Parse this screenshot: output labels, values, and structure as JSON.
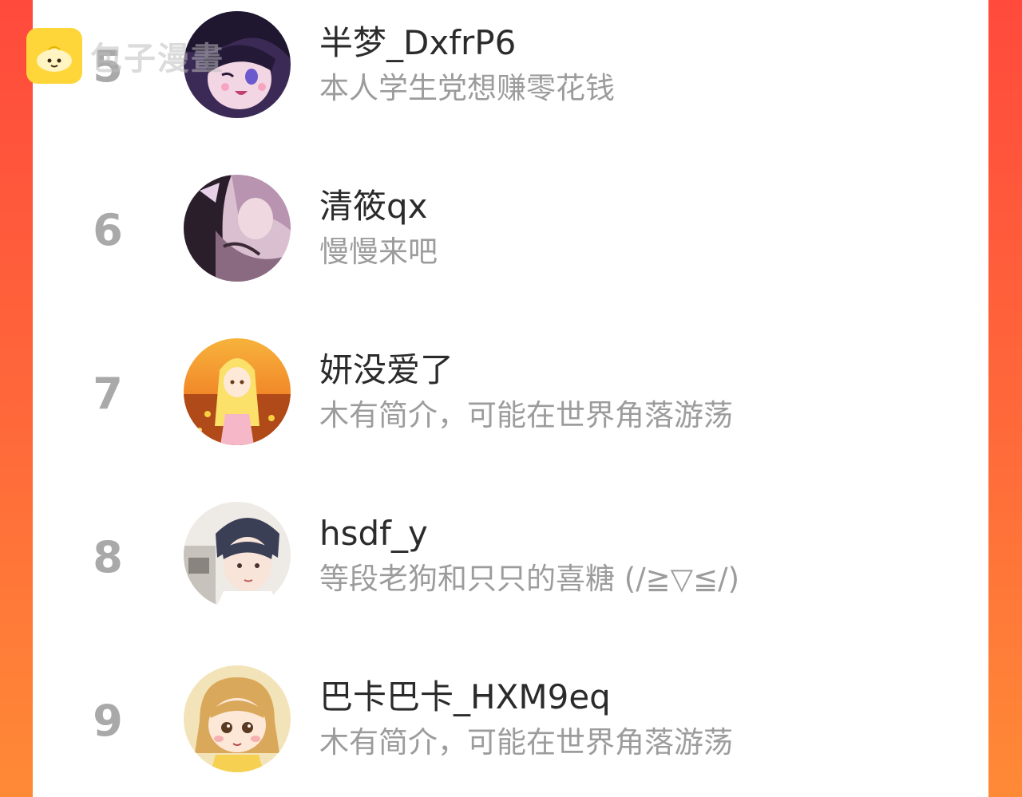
{
  "watermark": {
    "brand_text": "包子漫畫",
    "icon": "bun-logo-icon",
    "icon_color": "#ffd63a"
  },
  "colors": {
    "background_gradient_start": "#ff4a3c",
    "background_gradient_end": "#ff8a36",
    "card": "#ffffff",
    "rank_number": "#a9a9a9",
    "user_name": "#2b2b2b",
    "user_bio": "#9c9c9c"
  },
  "ranking": [
    {
      "rank": "5",
      "name": "半梦_DxfrP6",
      "bio": "本人学生党想赚零花钱",
      "avatar": "dark-hair-anime-girl-avatar"
    },
    {
      "rank": "6",
      "name": "清筱qx",
      "bio": "慢慢来吧",
      "avatar": "pink-toned-anime-couple-avatar"
    },
    {
      "rank": "7",
      "name": "妍没爱了",
      "bio": "木有简介，可能在世界角落游荡",
      "avatar": "blonde-girl-sunset-field-avatar"
    },
    {
      "rank": "8",
      "name": "hsdf_y",
      "bio": "等段老狗和只只的喜糖 (/≧▽≦/)",
      "avatar": "dark-hair-anime-boy-avatar"
    },
    {
      "rank": "9",
      "name": "巴卡巴卡_HXM9eq",
      "bio": "木有简介，可能在世界角落游荡",
      "avatar": "chibi-blonde-girl-avatar"
    }
  ]
}
